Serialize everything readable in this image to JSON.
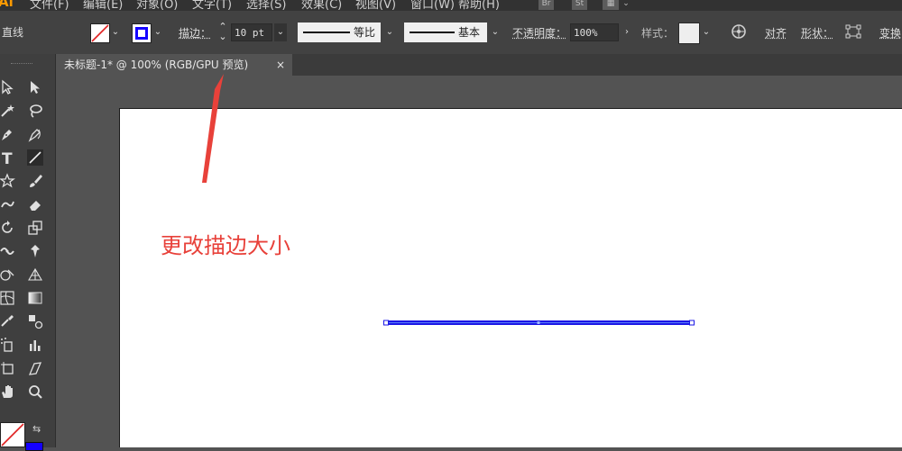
{
  "app": {
    "logo": "Ai"
  },
  "menu": [
    "文件(F)",
    "编辑(E)",
    "对象(O)",
    "文字(T)",
    "选择(S)",
    "效果(C)",
    "视图(V)",
    "窗口(W)",
    "帮助(H)"
  ],
  "menu_icons": [
    "Br",
    "St"
  ],
  "control_bar": {
    "tool_name": "直线",
    "stroke_label": "描边：",
    "stroke_weight": "10 pt",
    "profile_label": "等比",
    "brush_label": "基本",
    "opacity_label": "不透明度：",
    "opacity_value": "100%",
    "style_label": "样式：",
    "align_label": "对齐",
    "shape_label": "形状：",
    "transform_label": "变换",
    "stroke_color": "#1400ff"
  },
  "document": {
    "tab_title": "未标题-1* @ 100% (RGB/GPU 预览)",
    "close_glyph": "×"
  },
  "annotation": {
    "text": "更改描边大小",
    "color": "#e8413a"
  },
  "artwork": {
    "line_color": "#1a16e6"
  },
  "tools": [
    "selection-tool",
    "direct-selection-tool",
    "magic-wand-tool",
    "lasso-tool",
    "pen-tool",
    "curvature-tool",
    "type-tool",
    "line-segment-tool",
    "star-tool",
    "paintbrush-tool",
    "shaper-tool",
    "eraser-tool",
    "rotate-tool",
    "scale-tool",
    "width-tool",
    "puppet-warp-tool",
    "shape-builder-tool",
    "perspective-grid-tool",
    "mesh-tool",
    "gradient-tool",
    "eyedropper-tool",
    "blend-tool",
    "symbol-sprayer-tool",
    "column-graph-tool",
    "artboard-tool",
    "slice-tool",
    "hand-tool",
    "zoom-tool"
  ]
}
